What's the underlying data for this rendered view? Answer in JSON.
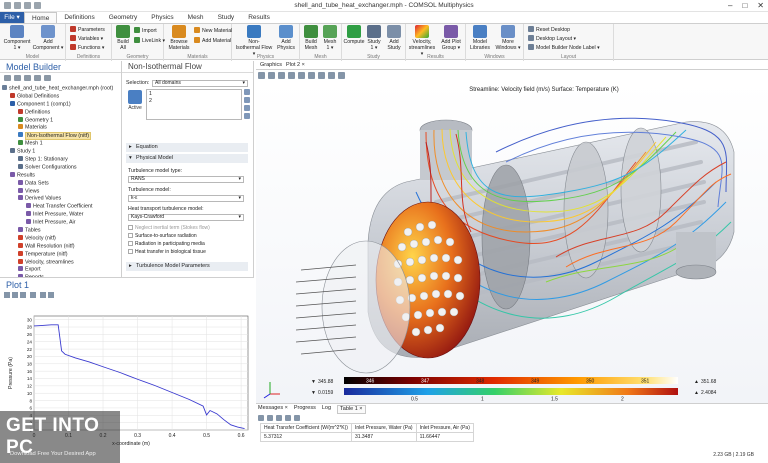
{
  "window": {
    "title": "shell_and_tube_heat_exchanger.mph - COMSOL Multiphysics",
    "minimize": "–",
    "maximize": "□",
    "close": "✕"
  },
  "menubar": {
    "file": "File ▾",
    "tabs": [
      "Home",
      "Definitions",
      "Geometry",
      "Physics",
      "Mesh",
      "Study",
      "Results"
    ],
    "active_tab": "Home"
  },
  "ribbon": {
    "groups": [
      "Model",
      "Definitions",
      "Geometry",
      "Materials",
      "Physics",
      "Mesh",
      "Study",
      "Results",
      "Windows",
      "Layout"
    ],
    "buttons": {
      "component": "Component\n1 ▾",
      "add_component": "Add\nComponent ▾",
      "parameters": "Parameters",
      "variables": "Variables ▾",
      "functions": "Functions ▾",
      "build_all": "Build\nAll",
      "import": "Import",
      "livelink": "LiveLink ▾",
      "browse_materials": "Browse\nMaterials",
      "new_material": "New Material",
      "add_material": "Add Material",
      "physics": "Non-\nIsothermal Flow ▾",
      "add_physics": "Add\nPhysics",
      "build_mesh": "Build\nMesh",
      "mesh": "Mesh\n1 ▾",
      "compute": "Compute",
      "study": "Study\n1 ▾",
      "add_study": "Add\nStudy",
      "velocity_streamlines": "Velocity,\nstreamlines ▾",
      "add_plot_group": "Add Plot\nGroup ▾",
      "model_libraries": "Model\nLibraries",
      "more_windows": "More\nWindows ▾",
      "reset_desktop": "Reset Desktop",
      "desktop_layout": "Desktop Layout ▾",
      "model_builder_node_label": "Model Builder Node Label ▾"
    }
  },
  "model_builder": {
    "title": "Model Builder",
    "tree": [
      {
        "label": "shell_and_tube_heat_exchanger.mph (root)",
        "depth": 0,
        "color": "#6b7f99"
      },
      {
        "label": "Global Definitions",
        "depth": 1,
        "color": "#c0392b"
      },
      {
        "label": "Component 1 (comp1)",
        "depth": 1,
        "color": "#2d5fa8"
      },
      {
        "label": "Definitions",
        "depth": 2,
        "color": "#c0392b"
      },
      {
        "label": "Geometry 1",
        "depth": 2,
        "color": "#3f8f3f"
      },
      {
        "label": "Materials",
        "depth": 2,
        "color": "#d98a1f"
      },
      {
        "label": "Non-Isothermal Flow (nitf)",
        "depth": 2,
        "color": "#3a7ac0",
        "selected": true
      },
      {
        "label": "Mesh 1",
        "depth": 2,
        "color": "#3f8f3f"
      },
      {
        "label": "Study 1",
        "depth": 1,
        "color": "#5b6f8a"
      },
      {
        "label": "Step 1: Stationary",
        "depth": 2,
        "color": "#5b6f8a"
      },
      {
        "label": "Solver Configurations",
        "depth": 2,
        "color": "#5b6f8a"
      },
      {
        "label": "Results",
        "depth": 1,
        "color": "#7a5aa8"
      },
      {
        "label": "Data Sets",
        "depth": 2,
        "color": "#7a5aa8"
      },
      {
        "label": "Views",
        "depth": 2,
        "color": "#7a5aa8"
      },
      {
        "label": "Derived Values",
        "depth": 2,
        "color": "#7a5aa8"
      },
      {
        "label": "Heat Transfer Coefficient",
        "depth": 3,
        "color": "#7a5aa8"
      },
      {
        "label": "Inlet Pressure, Water",
        "depth": 3,
        "color": "#7a5aa8"
      },
      {
        "label": "Inlet Pressure, Air",
        "depth": 3,
        "color": "#7a5aa8"
      },
      {
        "label": "Tables",
        "depth": 2,
        "color": "#7a5aa8"
      },
      {
        "label": "Velocity (nitf)",
        "depth": 2,
        "color": "#d0402a"
      },
      {
        "label": "Wall Resolution (nitf)",
        "depth": 2,
        "color": "#d0402a"
      },
      {
        "label": "Temperature (nitf)",
        "depth": 2,
        "color": "#d0402a"
      },
      {
        "label": "Velocity, streamlines",
        "depth": 2,
        "color": "#d0402a"
      },
      {
        "label": "Export",
        "depth": 2,
        "color": "#7a5aa8"
      },
      {
        "label": "Reports",
        "depth": 2,
        "color": "#7a5aa8"
      }
    ]
  },
  "settings": {
    "title": "Non-Isothermal Flow",
    "selection_label": "Selection:",
    "selection_value": "All domains",
    "domains": [
      "1",
      "2"
    ],
    "active_label": "Active",
    "sections": {
      "equation": "Equation",
      "physical_model": "Physical Model",
      "turbulence_parameters": "Turbulence Model Parameters"
    },
    "turbulence_model_type_label": "Turbulence model type:",
    "turbulence_model_type": "RANS",
    "turbulence_model_label": "Turbulence model:",
    "turbulence_model": "k-ε",
    "heat_transport_label": "Heat transport turbulence model:",
    "heat_transport": "Kays-Crawford",
    "checkboxes": [
      "Neglect inertial term (Stokes flow)",
      "Surface-to-surface radiation",
      "Radiation in participating media",
      "Heat transfer in biological tissue"
    ]
  },
  "graphics": {
    "tabs": [
      "Graphics",
      "Plot 2 ×"
    ],
    "plot_title": "Streamline: Velocity field (m/s) Surface: Temperature (K)",
    "legend": {
      "temperature": {
        "min": "345.88",
        "max": "351.68",
        "ticks": [
          "346",
          "347",
          "348",
          "349",
          "350",
          "351"
        ]
      },
      "velocity": {
        "min": "0.0159",
        "max": "2.4084",
        "ticks": [
          "0.5",
          "1",
          "1.5",
          "2"
        ]
      }
    }
  },
  "plot1": {
    "title": "Plot 1",
    "chart_data": {
      "type": "line",
      "title": "",
      "xlabel": "x-coordinate (m)",
      "ylabel": "Pressure (Pa)",
      "xlim": [
        0,
        0.62
      ],
      "ylim": [
        0,
        31
      ],
      "xticks": [
        "0",
        "0.1",
        "0.2",
        "0.3",
        "0.4",
        "0.5",
        "0.6"
      ],
      "yticks": [
        "0",
        "2",
        "4",
        "6",
        "8",
        "10",
        "12",
        "14",
        "16",
        "18",
        "20",
        "22",
        "24",
        "26",
        "28",
        "30"
      ],
      "series": [
        {
          "name": "",
          "color": "#3a3acf",
          "x": [
            0.0,
            0.02,
            0.05,
            0.07,
            0.08,
            0.09,
            0.12,
            0.16,
            0.2,
            0.25,
            0.3,
            0.35,
            0.4,
            0.45,
            0.49,
            0.5,
            0.51,
            0.53,
            0.55,
            0.57,
            0.59,
            0.61
          ],
          "y": [
            28.3,
            28.4,
            28.6,
            28.6,
            21.5,
            20.6,
            19.6,
            18.5,
            17.2,
            15.6,
            13.8,
            12.1,
            10.2,
            8.3,
            6.5,
            4.1,
            5.3,
            4.4,
            2.8,
            1.4,
            0.8,
            0.4
          ]
        }
      ],
      "grid": true
    }
  },
  "messages": {
    "tabs": [
      "Messages ×",
      "Progress",
      "Log",
      "Table 1 ×"
    ],
    "active_tab": "Table 1 ×",
    "headers": [
      "Heat Transfer Coefficient (W/(m^2*K))",
      "Inlet Pressure, Water (Pa)",
      "Inlet Pressure, Air (Pa)"
    ],
    "row": [
      "5.37312",
      "31.3487",
      "11.66447"
    ],
    "memory": "2.23 GB | 2.19 GB"
  },
  "watermark": {
    "main": "GET INTO PC",
    "sub": "Download Free Your Desired App"
  },
  "colors": {
    "accent": "#2d5fa8",
    "selection": "#f6e3a7"
  }
}
